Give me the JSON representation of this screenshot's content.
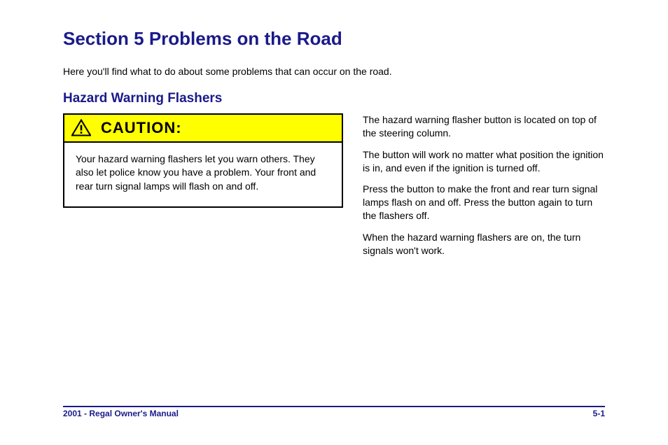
{
  "heading_main": "Section 5 Problems on the Road",
  "intro_text": "Here you'll find what to do about some problems that can occur on the road.",
  "heading_sub": "Hazard Warning Flashers",
  "caution": {
    "label": "CAUTION:",
    "body": "Your hazard warning flashers let you warn others. They also let police know you have a problem. Your front and rear turn signal lamps will flash on and off."
  },
  "right_paragraphs": [
    "The hazard warning flasher button is located on top of the steering column.",
    "The button will work no matter what position the ignition is in, and even if the ignition is turned off.",
    "Press the button to make the front and rear turn signal lamps flash on and off. Press the button again to turn the flashers off.",
    "When the hazard warning flashers are on, the turn signals won't work."
  ],
  "footer": {
    "page_prefix": "5-",
    "page_number": "1",
    "prev": "2001 - Regal Owner's Manual"
  }
}
